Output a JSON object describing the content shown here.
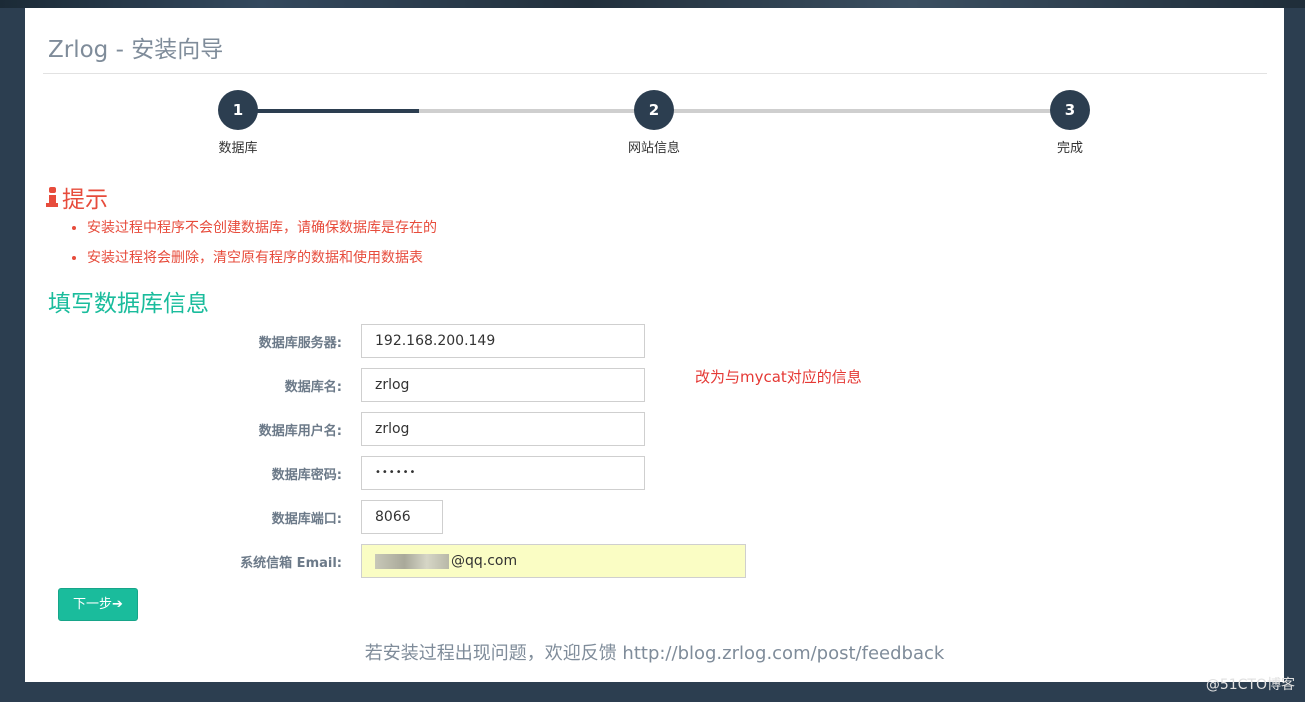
{
  "header": {
    "title": "Zrlog - 安装向导"
  },
  "steps": [
    {
      "number": "1",
      "label": "数据库"
    },
    {
      "number": "2",
      "label": "网站信息"
    },
    {
      "number": "3",
      "label": "完成"
    }
  ],
  "step_progress": {
    "current_step": 1,
    "total_steps": 3
  },
  "tips": {
    "heading": "提示",
    "items": [
      "安装过程中程序不会创建数据库，请确保数据库是存在的",
      "安装过程将会删除，清空原有程序的数据和使用数据表"
    ]
  },
  "form": {
    "heading": "填写数据库信息",
    "fields": {
      "host": {
        "label": "数据库服务器:",
        "value": "192.168.200.149"
      },
      "dbname": {
        "label": "数据库名:",
        "value": "zrlog"
      },
      "user": {
        "label": "数据库用户名:",
        "value": "zrlog"
      },
      "password": {
        "label": "数据库密码:",
        "value": "••••••"
      },
      "port": {
        "label": "数据库端口:",
        "value": "8066"
      },
      "email": {
        "label": "系统信箱 Email:",
        "value_visible": "@qq.com"
      }
    },
    "next_button": "下一步"
  },
  "annotation": "改为与mycat对应的信息",
  "footer": {
    "feedback": "若安装过程出现问题，欢迎反馈 http://blog.zrlog.com/post/feedback"
  },
  "watermark": "@51CTO博客",
  "colors": {
    "background": "#2c3e50",
    "accent": "#1abc9c",
    "warning": "#e74c3c",
    "step_active": "#2c3e50",
    "email_highlight": "#fafdc4"
  }
}
